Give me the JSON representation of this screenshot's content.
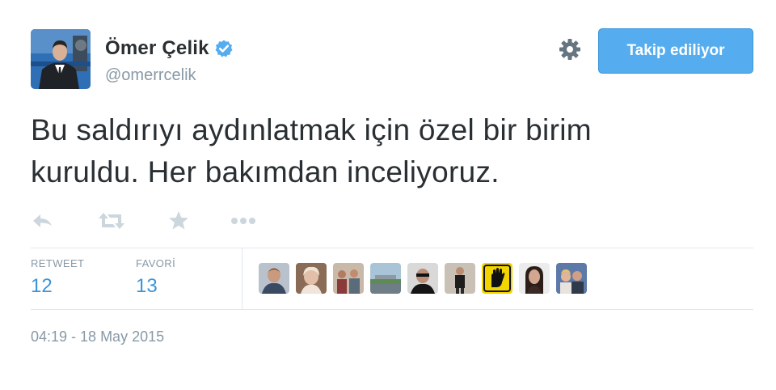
{
  "author": {
    "display_name": "Ömer Çelik",
    "handle": "@omerrcelik",
    "verified": true
  },
  "header": {
    "follow_button_label": "Takip ediliyor",
    "settings_icon": "gear-icon"
  },
  "tweet": {
    "text_line1": "Bu saldırıyı aydınlatmak için özel bir birim",
    "text_line2": "kuruldu. Her bakımdan inceliyoruz.",
    "timestamp": "04:19 - 18 May 2015"
  },
  "actions": [
    {
      "icon": "reply-icon"
    },
    {
      "icon": "retweet-icon"
    },
    {
      "icon": "favorite-star-icon"
    },
    {
      "icon": "more-dots-icon"
    }
  ],
  "stats": {
    "retweet_label": "RETWEET",
    "retweet_count": "12",
    "favorite_label": "FAVORİ",
    "favorite_count": "13"
  },
  "colors": {
    "accent_blue": "#55acee",
    "count_blue": "#3b94d9",
    "muted_gray": "#8899a6",
    "text_dark": "#292f33",
    "divider": "#e1e8ed"
  }
}
